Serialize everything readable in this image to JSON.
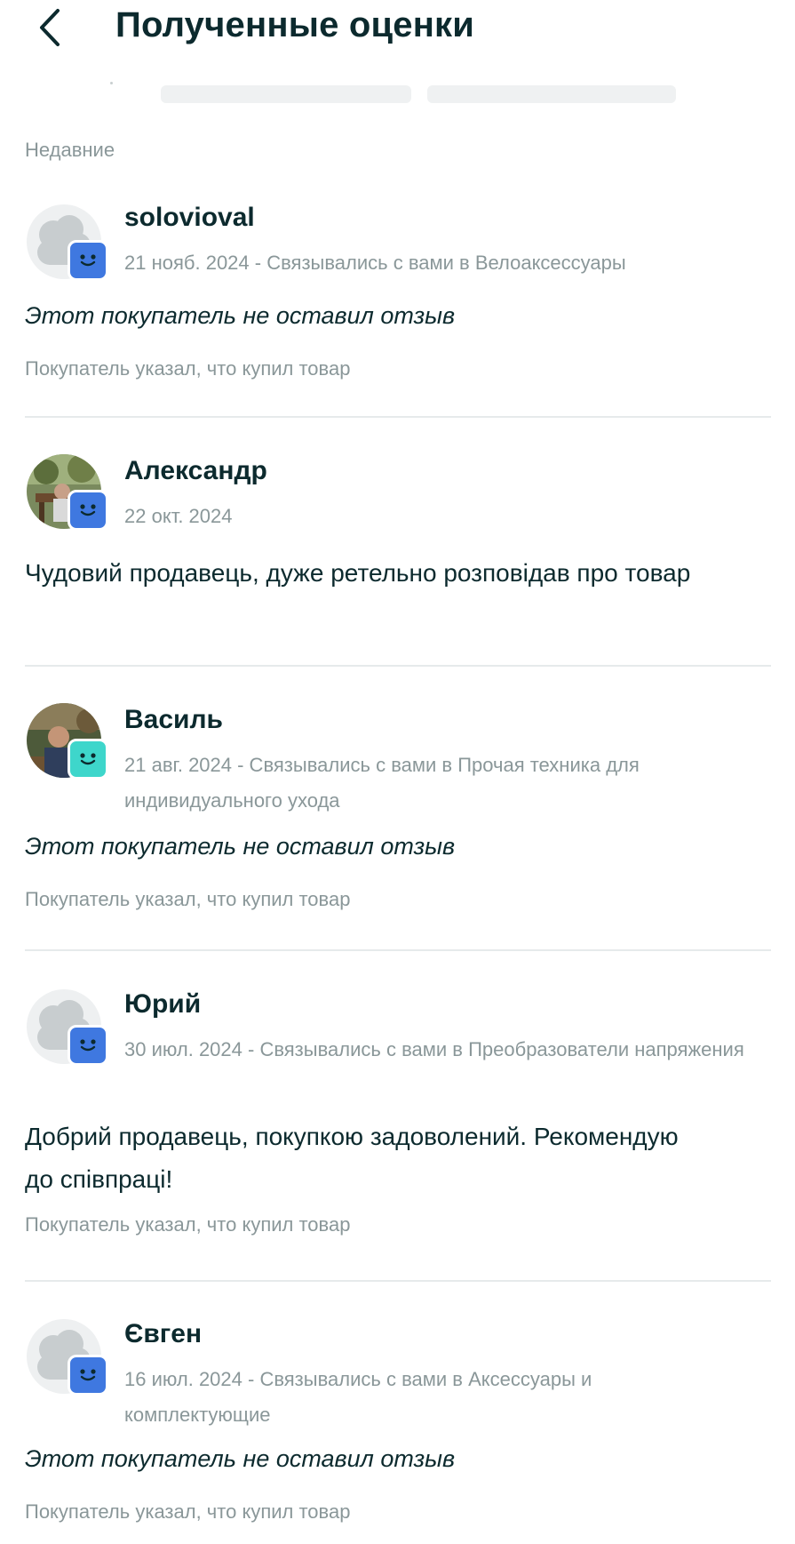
{
  "header": {
    "title": "Полученные оценки",
    "back_icon": "chevron-left-icon"
  },
  "section": {
    "label": "Недавние"
  },
  "colors": {
    "badge_blue": "#3f78e0",
    "badge_teal": "#3ed6cb",
    "text_dark": "#0c2a2e",
    "text_muted": "#8a9799"
  },
  "reviews": [
    {
      "name": "solovioval",
      "meta": "21 нояб. 2024 - Связывались с вами в Велоаксессуары",
      "comment": "Этот покупатель не оставил отзыв",
      "comment_style": "italic",
      "purchase_note": "Покупатель указал, что купил товар",
      "avatar": "placeholder",
      "badge_color": "blue"
    },
    {
      "name": "Александр",
      "meta": "22 окт. 2024",
      "comment": "Чудовий продавець, дуже ретельно розповідав про товар",
      "comment_style": "normal",
      "purchase_note": "",
      "avatar": "photo",
      "badge_color": "blue"
    },
    {
      "name": "Василь",
      "meta": "21 авг. 2024 - Связывались с вами в Прочая техника для индивидуального ухода",
      "comment": "Этот покупатель не оставил отзыв",
      "comment_style": "italic",
      "purchase_note": "Покупатель указал, что купил товар",
      "avatar": "photo",
      "badge_color": "teal"
    },
    {
      "name": "Юрий",
      "meta": "30 июл. 2024 - Связывались с вами в Преобразователи напряжения",
      "comment": "Добрий продавець, покупкою задоволений. Рекомендую до співпраці!",
      "comment_style": "normal",
      "purchase_note": "Покупатель указал, что купил товар",
      "avatar": "placeholder",
      "badge_color": "blue"
    },
    {
      "name": "Євген",
      "meta": "16 июл. 2024 - Связывались с вами в Аксессуары и комплектующие",
      "comment": "Этот покупатель не оставил отзыв",
      "comment_style": "italic",
      "purchase_note": "Покупатель указал, что купил товар",
      "avatar": "placeholder",
      "badge_color": "blue"
    }
  ]
}
